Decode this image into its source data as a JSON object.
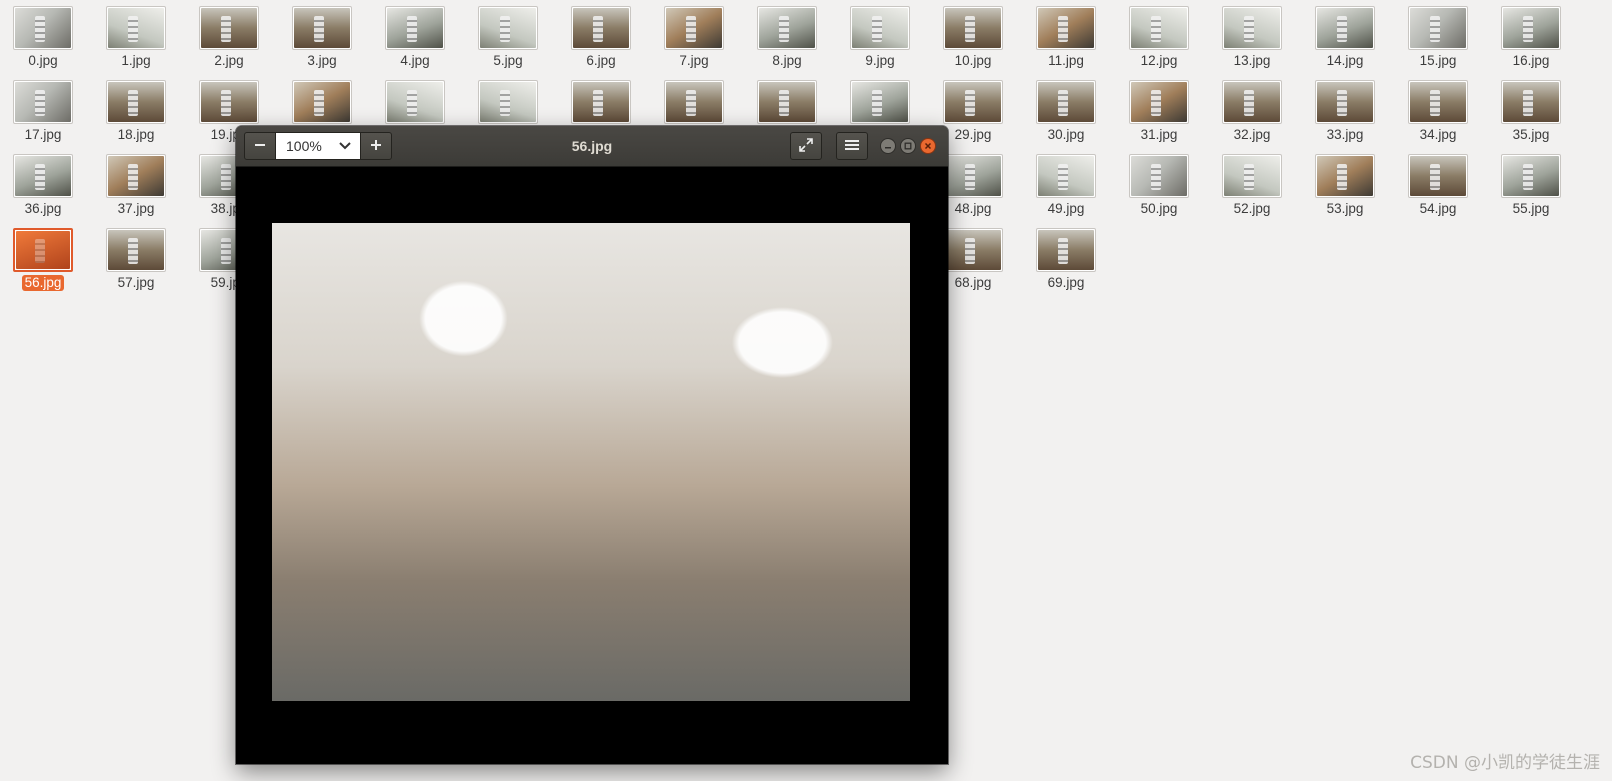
{
  "files": [
    {
      "name": "0.jpg",
      "tone": 0
    },
    {
      "name": "1.jpg",
      "tone": 3
    },
    {
      "name": "2.jpg",
      "tone": 2
    },
    {
      "name": "3.jpg",
      "tone": 2
    },
    {
      "name": "4.jpg",
      "tone": 1
    },
    {
      "name": "5.jpg",
      "tone": 3
    },
    {
      "name": "6.jpg",
      "tone": 2
    },
    {
      "name": "7.jpg",
      "tone": 4
    },
    {
      "name": "8.jpg",
      "tone": 1
    },
    {
      "name": "9.jpg",
      "tone": 3
    },
    {
      "name": "10.jpg",
      "tone": 2
    },
    {
      "name": "11.jpg",
      "tone": 4
    },
    {
      "name": "12.jpg",
      "tone": 3
    },
    {
      "name": "13.jpg",
      "tone": 3
    },
    {
      "name": "14.jpg",
      "tone": 1
    },
    {
      "name": "15.jpg",
      "tone": 0
    },
    {
      "name": "16.jpg",
      "tone": 1
    },
    {
      "name": "17.jpg",
      "tone": 0
    },
    {
      "name": "18.jpg",
      "tone": 2
    },
    {
      "name": "19.jpg",
      "tone": 2
    },
    {
      "name": "",
      "tone": 4
    },
    {
      "name": "",
      "tone": 3
    },
    {
      "name": "",
      "tone": 3
    },
    {
      "name": "",
      "tone": 2
    },
    {
      "name": "",
      "tone": 2
    },
    {
      "name": "",
      "tone": 2
    },
    {
      "name": "",
      "tone": 1
    },
    {
      "name": "29.jpg",
      "tone": 2
    },
    {
      "name": "30.jpg",
      "tone": 2
    },
    {
      "name": "31.jpg",
      "tone": 4
    },
    {
      "name": "32.jpg",
      "tone": 2
    },
    {
      "name": "33.jpg",
      "tone": 2
    },
    {
      "name": "34.jpg",
      "tone": 2
    },
    {
      "name": "35.jpg",
      "tone": 2
    },
    {
      "name": "36.jpg",
      "tone": 1
    },
    {
      "name": "37.jpg",
      "tone": 4
    },
    {
      "name": "38.jpg",
      "tone": 1
    },
    {
      "name": "",
      "tone": 1
    },
    {
      "name": "",
      "tone": 1
    },
    {
      "name": "",
      "tone": 1
    },
    {
      "name": "",
      "tone": 1
    },
    {
      "name": "",
      "tone": 1
    },
    {
      "name": "",
      "tone": 1
    },
    {
      "name": "",
      "tone": 1
    },
    {
      "name": "48.jpg",
      "tone": 1
    },
    {
      "name": "49.jpg",
      "tone": 3
    },
    {
      "name": "50.jpg",
      "tone": 0
    },
    {
      "name": "52.jpg",
      "tone": 3
    },
    {
      "name": "53.jpg",
      "tone": 4
    },
    {
      "name": "54.jpg",
      "tone": 2
    },
    {
      "name": "55.jpg",
      "tone": 1
    },
    {
      "name": "56.jpg",
      "tone": 4,
      "selected": true
    },
    {
      "name": "57.jpg",
      "tone": 2
    },
    {
      "name": "59.jpg",
      "tone": 1
    },
    {
      "name": "",
      "tone": 1
    },
    {
      "name": "",
      "tone": 1
    },
    {
      "name": "",
      "tone": 1
    },
    {
      "name": "",
      "tone": 1
    },
    {
      "name": "",
      "tone": 1
    },
    {
      "name": "",
      "tone": 1
    },
    {
      "name": "",
      "tone": 1
    },
    {
      "name": "68.jpg",
      "tone": 2
    },
    {
      "name": "69.jpg",
      "tone": 2
    }
  ],
  "viewer": {
    "title": "56.jpg",
    "zoom": "100%",
    "icons": {
      "zoom_out": "minus-icon",
      "zoom_in": "plus-icon",
      "zoom_dropdown": "chevron-down-icon",
      "fullscreen": "fullscreen-icon",
      "menu": "hamburger-menu-icon",
      "minimize": "minimize-icon",
      "maximize": "maximize-icon",
      "close": "close-icon"
    }
  },
  "watermark": "CSDN @小凯的学徒生涯",
  "colors": {
    "desktop_bg": "#f2f1f0",
    "selection": "#e9682f",
    "headerbar": "#3c3b37"
  }
}
